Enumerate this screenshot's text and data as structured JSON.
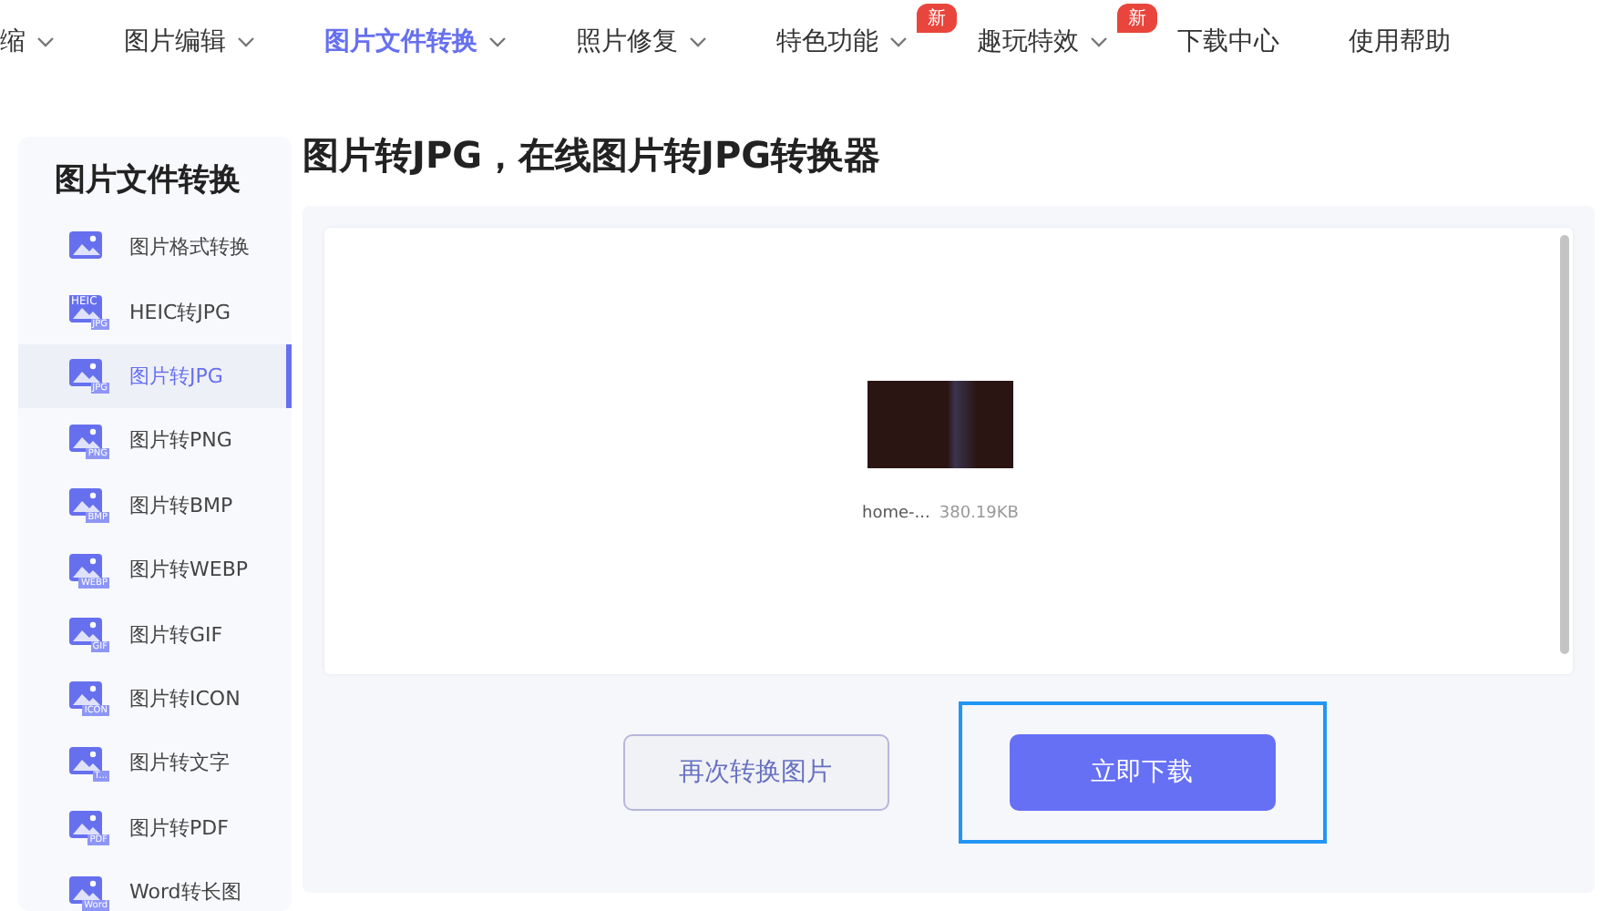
{
  "nav": [
    {
      "label": "缩",
      "caret": true,
      "selected": false
    },
    {
      "label": "图片编辑",
      "caret": true,
      "selected": false
    },
    {
      "label": "图片文件转换",
      "caret": true,
      "selected": true
    },
    {
      "label": "照片修复",
      "caret": true,
      "selected": false
    },
    {
      "label": "特色功能",
      "caret": true,
      "selected": false,
      "badge": "新"
    },
    {
      "label": "趣玩特效",
      "caret": true,
      "selected": false,
      "badge": "新"
    },
    {
      "label": "下载中心",
      "caret": false,
      "selected": false
    },
    {
      "label": "使用帮助",
      "caret": false,
      "selected": false
    }
  ],
  "sidebar": {
    "title": "图片文件转换",
    "items": [
      {
        "label": "图片格式转换",
        "selected": false
      },
      {
        "label": "HEIC转JPG",
        "selected": false,
        "icon_labels": [
          "HEIC",
          "JPG"
        ]
      },
      {
        "label": "图片转JPG",
        "selected": true,
        "icon_labels": [
          "JPG"
        ]
      },
      {
        "label": "图片转PNG",
        "selected": false,
        "icon_labels": [
          "PNG"
        ]
      },
      {
        "label": "图片转BMP",
        "selected": false,
        "icon_labels": [
          "BMP"
        ]
      },
      {
        "label": "图片转WEBP",
        "selected": false,
        "icon_labels": [
          "WEBP"
        ]
      },
      {
        "label": "图片转GIF",
        "selected": false,
        "icon_labels": [
          "GIF"
        ]
      },
      {
        "label": "图片转ICON",
        "selected": false,
        "icon_labels": [
          "ICON"
        ]
      },
      {
        "label": "图片转文字",
        "selected": false,
        "icon_labels": [
          "T..."
        ]
      },
      {
        "label": "图片转PDF",
        "selected": false,
        "icon_labels": [
          "PDF"
        ]
      },
      {
        "label": "Word转长图",
        "selected": false,
        "icon_labels": [
          "Word"
        ]
      }
    ]
  },
  "main": {
    "title": "图片转JPG，在线图片转JPG转换器",
    "file": {
      "name": "home-...",
      "size": "380.19KB"
    },
    "buttons": [
      {
        "label": "再次转换图片",
        "kind": "secondary",
        "focused": false
      },
      {
        "label": "立即下载",
        "kind": "primary",
        "focused": true
      }
    ]
  }
}
